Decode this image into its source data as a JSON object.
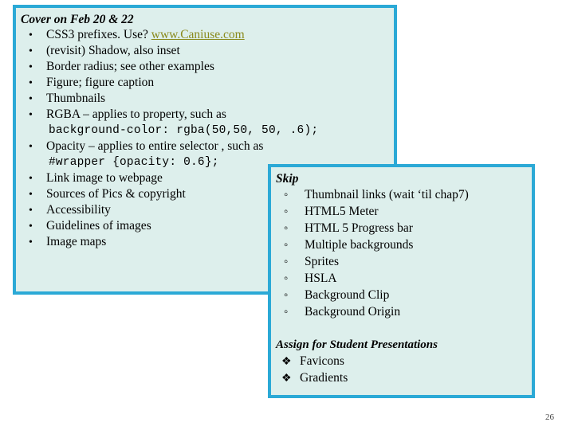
{
  "slide": {
    "page_number": "26",
    "colors": {
      "border": "#2BA9D6",
      "fill": "#DDEFEC",
      "link": "#8A8A1D",
      "text": "#000000",
      "background": "#FFFFFF"
    }
  },
  "main_box": {
    "heading": "Cover on Feb 20 & 22",
    "items": [
      {
        "type": "bullet",
        "text_before": "CSS3 prefixes. Use?  ",
        "link": "www.Caniuse.com",
        "text_after": ""
      },
      {
        "type": "bullet",
        "text": "(revisit) Shadow, also inset"
      },
      {
        "type": "bullet",
        "text": "Border radius; see other examples"
      },
      {
        "type": "bullet",
        "text": "Figure; figure caption"
      },
      {
        "type": "bullet",
        "text": "Thumbnails"
      },
      {
        "type": "bullet",
        "text": "RGBA  – applies to property, such as"
      },
      {
        "type": "code",
        "text": "background-color: rgba(50,50, 50, .6);"
      },
      {
        "type": "bullet",
        "text": "Opacity – applies to entire selector , such as"
      },
      {
        "type": "code",
        "text": "#wrapper {opacity: 0.6};"
      },
      {
        "type": "bullet",
        "text": "Link image to webpage"
      },
      {
        "type": "bullet",
        "text": "Sources of Pics & copyright"
      },
      {
        "type": "bullet",
        "text": "Accessibility"
      },
      {
        "type": "bullet",
        "text": "Guidelines of images"
      },
      {
        "type": "bullet",
        "text": "Image maps"
      }
    ]
  },
  "skip_box": {
    "heading": "Skip",
    "items": [
      "Thumbnail links (wait ‘til chap7)",
      "HTML5 Meter",
      "HTML 5 Progress bar",
      "Multiple backgrounds",
      "Sprites",
      "HSLA",
      "Background Clip",
      "Background Origin"
    ],
    "assign": {
      "heading": "Assign for Student Presentations",
      "items": [
        "Favicons",
        "Gradients"
      ]
    }
  }
}
